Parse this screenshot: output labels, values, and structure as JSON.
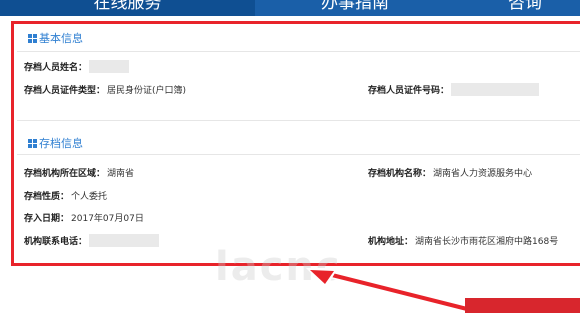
{
  "tabs": [
    {
      "label": "在线服务",
      "active": true
    },
    {
      "label": "办事指南",
      "active": false
    },
    {
      "label": "咨询",
      "active": false
    }
  ],
  "basic_info": {
    "title": "基本信息",
    "name_label": "存档人员姓名：",
    "id_type_label": "存档人员证件类型：",
    "id_type_value": "居民身份证(户口簿)",
    "id_number_label": "存档人员证件号码："
  },
  "archive_info": {
    "title": "存档信息",
    "region_label": "存档机构所在区域：",
    "region_value": "湖南省",
    "org_name_label": "存档机构名称：",
    "org_name_value": "湖南省人力资源服务中心",
    "nature_label": "存档性质：",
    "nature_value": "个人委托",
    "date_label": "存入日期：",
    "date_value": "2017年07月07日",
    "phone_label": "机构联系电话：",
    "address_label": "机构地址：",
    "address_value": "湖南省长沙市雨花区湘府中路168号"
  },
  "colors": {
    "frame": "#e8232a",
    "accent": "#2f7fd1",
    "tabbar": "#1a5fa8"
  },
  "icons": [
    "grid-icon",
    "arrow-icon"
  ]
}
